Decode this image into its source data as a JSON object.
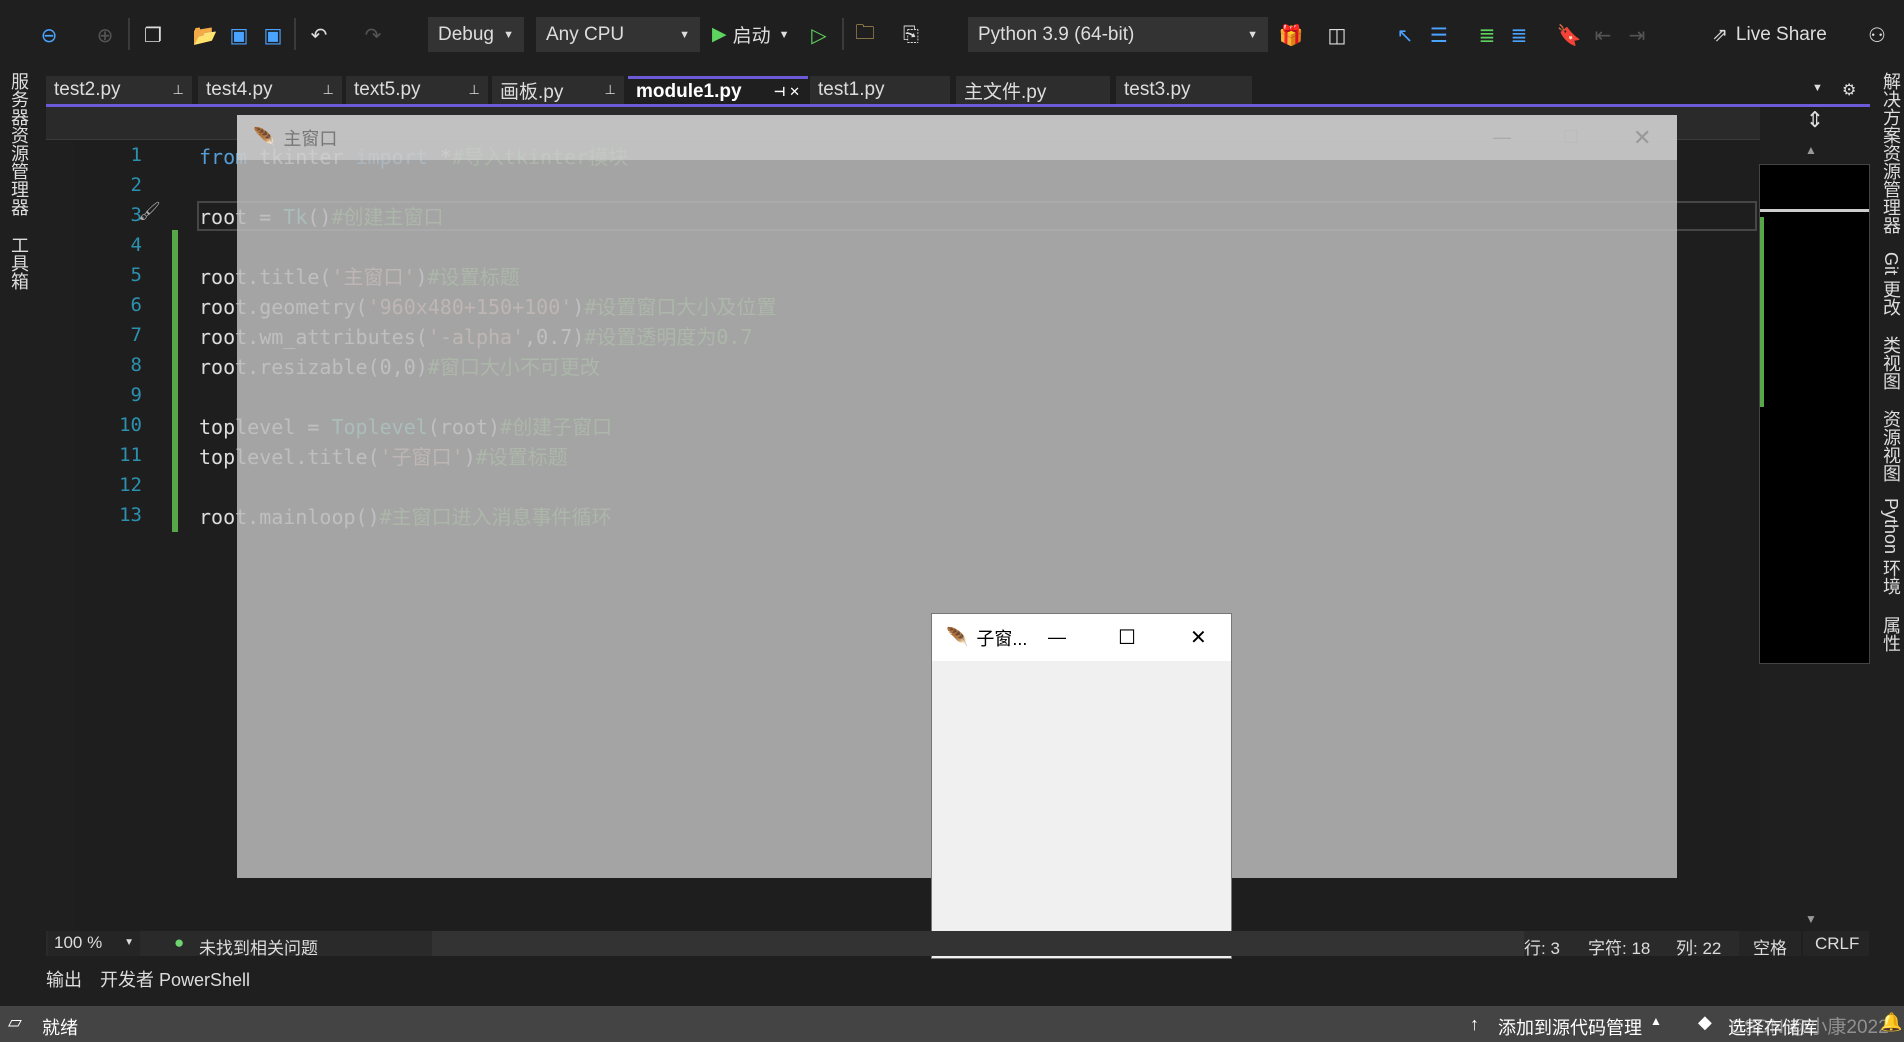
{
  "toolbar": {
    "config": "Debug",
    "platform": "Any CPU",
    "start_label": "启动",
    "python_env": "Python 3.9 (64-bit)",
    "live_share": "Live Share"
  },
  "tabs": [
    {
      "label": "test2.py",
      "pinned": true
    },
    {
      "label": "test4.py",
      "pinned": true
    },
    {
      "label": "text5.py",
      "pinned": true
    },
    {
      "label": "画板.py",
      "pinned": true
    },
    {
      "label": "module1.py",
      "pinned": true,
      "active": true
    },
    {
      "label": "test1.py"
    },
    {
      "label": "主文件.py"
    },
    {
      "label": "test3.py"
    }
  ],
  "left_sidebar": [
    "服务器资源管理器",
    "工具箱"
  ],
  "right_sidebar": [
    "解决方案资源管理器",
    "Git 更改",
    "类视图",
    "资源视图",
    "Python 环境",
    "属性"
  ],
  "code": {
    "line_numbers": [
      "1",
      "2",
      "3",
      "4",
      "5",
      "6",
      "7",
      "8",
      "9",
      "10",
      "11",
      "12",
      "13"
    ],
    "lines": [
      [
        {
          "t": "from",
          "c": "kw"
        },
        {
          "t": " tkinter "
        },
        {
          "t": "import",
          "c": "kw"
        },
        {
          "t": " *"
        },
        {
          "t": "#导入tkinter模块",
          "c": "cm"
        }
      ],
      [],
      [
        {
          "t": "root = "
        },
        {
          "t": "Tk",
          "c": "cls"
        },
        {
          "t": "()"
        },
        {
          "t": "#创建主窗口",
          "c": "cm"
        }
      ],
      [],
      [
        {
          "t": "root.title("
        },
        {
          "t": "'主窗口'",
          "c": "str"
        },
        {
          "t": ")"
        },
        {
          "t": "#设置标题",
          "c": "cm"
        }
      ],
      [
        {
          "t": "root.geometry("
        },
        {
          "t": "'960x480+150+100'",
          "c": "str"
        },
        {
          "t": ")"
        },
        {
          "t": "#设置窗口大小及位置",
          "c": "cm"
        }
      ],
      [
        {
          "t": "root.wm_attributes("
        },
        {
          "t": "'-alpha'",
          "c": "str"
        },
        {
          "t": ",0.7)"
        },
        {
          "t": "#设置透明度为0.7",
          "c": "cm"
        }
      ],
      [
        {
          "t": "root.resizable(0,0)"
        },
        {
          "t": "#窗口大小不可更改",
          "c": "cm"
        }
      ],
      [],
      [
        {
          "t": "toplevel = "
        },
        {
          "t": "Toplevel",
          "c": "cls"
        },
        {
          "t": "(root)"
        },
        {
          "t": "#创建子窗口",
          "c": "cm"
        }
      ],
      [
        {
          "t": "toplevel.title("
        },
        {
          "t": "'子窗口'",
          "c": "str"
        },
        {
          "t": ")"
        },
        {
          "t": "#设置标题",
          "c": "cm"
        }
      ],
      [],
      [
        {
          "t": "root.mainloop()"
        },
        {
          "t": "#主窗口进入消息事件循环",
          "c": "cm"
        }
      ]
    ]
  },
  "main_window": {
    "title": "主窗口"
  },
  "child_window": {
    "title": "子窗..."
  },
  "editor_status": {
    "zoom": "100 %",
    "issues": "未找到相关问题",
    "line": "行: 3",
    "char": "字符: 18",
    "col": "列: 22",
    "indent": "空格",
    "eol": "CRLF"
  },
  "output_tabs": [
    "输出",
    "开发者 PowerShell"
  ],
  "statusbar": {
    "ready": "就绪",
    "add_source": "添加到源代码管理",
    "select_repo": "选择存储库",
    "watermark": "CSDN @小康2022"
  },
  "colors": {
    "accent": "#6b5bd6",
    "keyword": "#569cd6",
    "comment": "#57a64a",
    "string": "#d69d85",
    "class": "#4ec9b0"
  }
}
